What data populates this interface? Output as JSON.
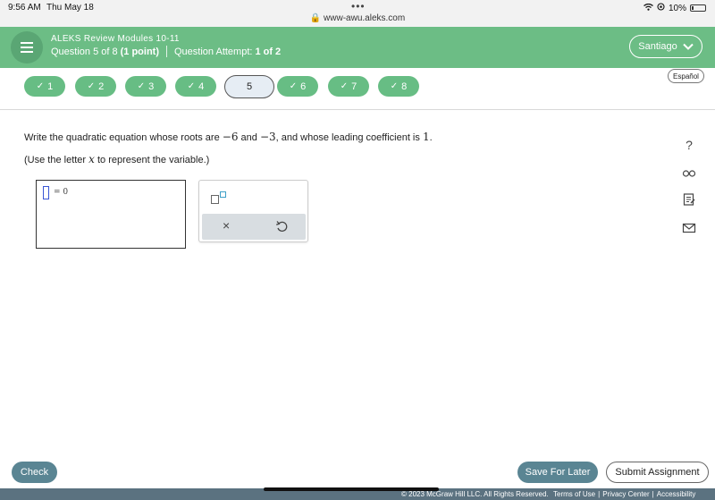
{
  "status_bar": {
    "time": "9:56 AM",
    "date": "Thu May 18",
    "url": "www-awu.aleks.com",
    "battery": "10%"
  },
  "header": {
    "module_title": "ALEKS Review Modules 10-11",
    "question_label": "Question 5 of 8",
    "points": "(1 point)",
    "attempt_label": "Question Attempt:",
    "attempt_value": "1 of 2",
    "user_name": "Santiago"
  },
  "question_nav": [
    {
      "label": "1",
      "done": true
    },
    {
      "label": "2",
      "done": true
    },
    {
      "label": "3",
      "done": true
    },
    {
      "label": "4",
      "done": true
    },
    {
      "label": "5",
      "done": false,
      "current": true
    },
    {
      "label": "6",
      "done": true
    },
    {
      "label": "7",
      "done": true
    },
    {
      "label": "8",
      "done": true
    }
  ],
  "language_button": "Español",
  "question": {
    "part1": "Write the quadratic equation whose roots are ",
    "root1": "−6",
    "part2": " and ",
    "root2": "−3",
    "part3": ", and whose leading coefficient is ",
    "coef": "1",
    "part4": ".",
    "hint_part1": "(Use the letter ",
    "hint_var": "x",
    "hint_part2": " to represent the variable.)"
  },
  "answer": {
    "equation_suffix": "= 0"
  },
  "keypad": {
    "clear_symbol": "×"
  },
  "footer": {
    "check_label": "Check",
    "save_label": "Save For Later",
    "submit_label": "Submit Assignment",
    "copyright": "© 2023 McGraw Hill LLC. All Rights Reserved.",
    "terms": "Terms of Use",
    "privacy": "Privacy Center",
    "accessibility": "Accessibility"
  },
  "colors": {
    "header_green": "#6cbd85",
    "pill_green": "#67bd84",
    "button_teal": "#5a8593",
    "footer_bar": "#5b7280"
  },
  "icons": [
    "hamburger-menu-icon",
    "chevron-down-icon",
    "check-icon",
    "help-icon",
    "glasses-icon",
    "notes-icon",
    "mail-icon",
    "undo-icon",
    "lock-icon",
    "wifi-icon"
  ]
}
